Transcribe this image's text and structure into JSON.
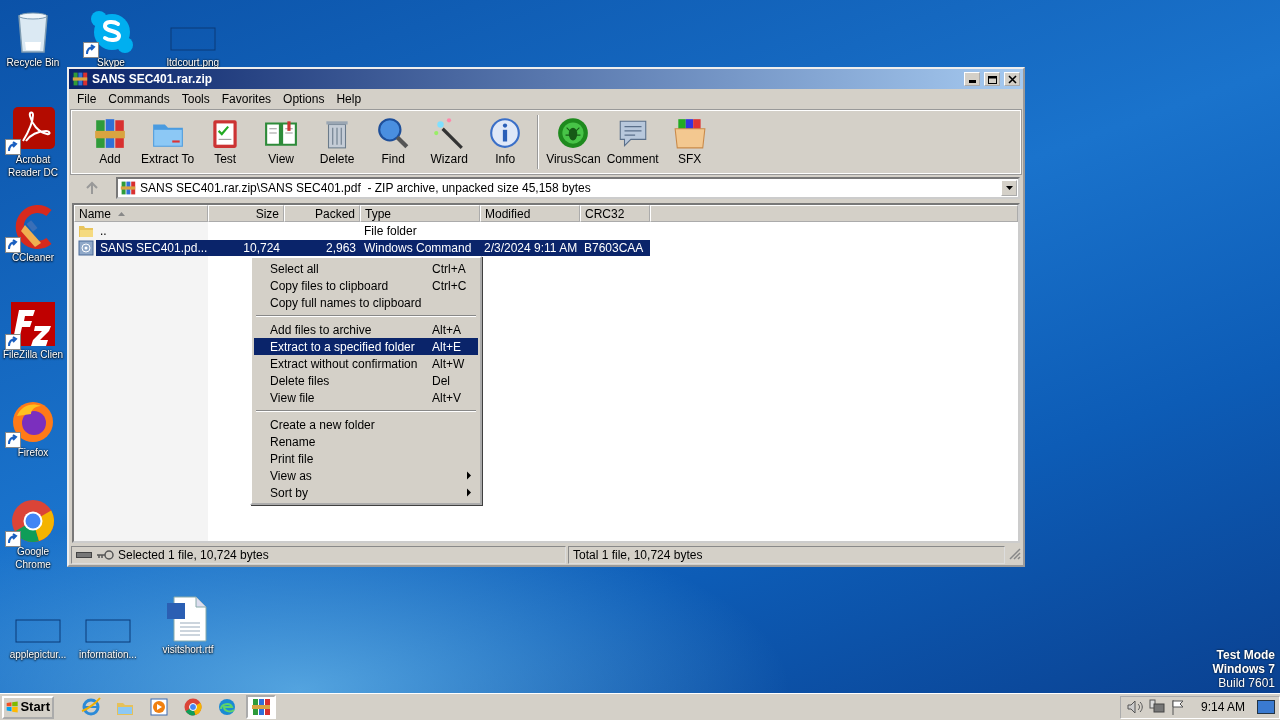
{
  "desktop_icons": [
    {
      "label": "Recycle Bin",
      "kind": "recycle",
      "shortcut": false
    },
    {
      "label": "Skype",
      "kind": "skype",
      "shortcut": true
    },
    {
      "label": "ltdcourt.png",
      "kind": "image",
      "shortcut": false
    },
    {
      "label": "Acrobat Reader DC",
      "kind": "acrobat",
      "shortcut": true
    },
    {
      "label": "CCleaner",
      "kind": "ccleaner",
      "shortcut": true
    },
    {
      "label": "FileZilla Clien",
      "kind": "filezilla",
      "shortcut": true
    },
    {
      "label": "Firefox",
      "kind": "firefox",
      "shortcut": true
    },
    {
      "label": "Google Chrome",
      "kind": "chrome",
      "shortcut": true
    },
    {
      "label": "applepictur...",
      "kind": "image",
      "shortcut": false
    },
    {
      "label": "information...",
      "kind": "image",
      "shortcut": false
    },
    {
      "label": "visitshort.rtf",
      "kind": "word",
      "shortcut": false
    }
  ],
  "window": {
    "title": "SANS SEC401.rar.zip",
    "menu": [
      "File",
      "Commands",
      "Tools",
      "Favorites",
      "Options",
      "Help"
    ],
    "toolbar": [
      {
        "label": "Add",
        "kind": "add",
        "separator_before": false
      },
      {
        "label": "Extract To",
        "kind": "extract",
        "separator_before": false
      },
      {
        "label": "Test",
        "kind": "test",
        "separator_before": false
      },
      {
        "label": "View",
        "kind": "view",
        "separator_before": false
      },
      {
        "label": "Delete",
        "kind": "delete",
        "separator_before": false
      },
      {
        "label": "Find",
        "kind": "find",
        "separator_before": false
      },
      {
        "label": "Wizard",
        "kind": "wizard",
        "separator_before": false
      },
      {
        "label": "Info",
        "kind": "info",
        "separator_before": false
      },
      {
        "label": "VirusScan",
        "kind": "virus",
        "separator_before": true
      },
      {
        "label": "Comment",
        "kind": "comment",
        "separator_before": false
      },
      {
        "label": "SFX",
        "kind": "sfx",
        "separator_before": false
      }
    ],
    "address": "SANS SEC401.rar.zip\\SANS SEC401.pdf  - ZIP archive, unpacked size 45,158 bytes",
    "columns": [
      {
        "label": "Name",
        "sorted": true
      },
      {
        "label": "Size",
        "sorted": false
      },
      {
        "label": "Packed",
        "sorted": false
      },
      {
        "label": "Type",
        "sorted": false
      },
      {
        "label": "Modified",
        "sorted": false
      },
      {
        "label": "CRC32",
        "sorted": false
      }
    ],
    "rows": [
      {
        "kind": "folder",
        "selected": false,
        "name": "..",
        "type": "File folder"
      },
      {
        "kind": "file",
        "selected": true,
        "name": "SANS SEC401.pd...",
        "size": "10,724",
        "packed": "2,963",
        "type": "Windows Command",
        "modified": "2/3/2024 9:11 AM",
        "crc32": "B7603CAA"
      }
    ],
    "status": [
      "Selected 1 file, 10,724 bytes",
      "Total 1 file, 10,724 bytes"
    ]
  },
  "context_menu": [
    [
      {
        "label": "Select all",
        "shortcut": "Ctrl+A",
        "selected": false,
        "submenu": false
      },
      {
        "label": "Copy files to clipboard",
        "shortcut": "Ctrl+C",
        "selected": false,
        "submenu": false
      },
      {
        "label": "Copy full names to clipboard",
        "selected": false,
        "submenu": false
      }
    ],
    [
      {
        "label": "Add files to archive",
        "shortcut": "Alt+A",
        "selected": false,
        "submenu": false
      },
      {
        "label": "Extract to a specified folder",
        "shortcut": "Alt+E",
        "selected": true,
        "submenu": false
      },
      {
        "label": "Extract without confirmation",
        "shortcut": "Alt+W",
        "selected": false,
        "submenu": false
      },
      {
        "label": "Delete files",
        "shortcut": "Del",
        "selected": false,
        "submenu": false
      },
      {
        "label": "View file",
        "shortcut": "Alt+V",
        "selected": false,
        "submenu": false
      }
    ],
    [
      {
        "label": "Create a new folder",
        "selected": false,
        "submenu": false
      },
      {
        "label": "Rename",
        "selected": false,
        "submenu": false
      },
      {
        "label": "Print file",
        "selected": false,
        "submenu": false
      },
      {
        "label": "View as",
        "selected": false,
        "submenu": true
      },
      {
        "label": "Sort by",
        "selected": false,
        "submenu": true
      }
    ]
  ],
  "taskbar": {
    "start": "Start",
    "apps": [
      {
        "kind": "ie",
        "active": false
      },
      {
        "kind": "explorer",
        "active": false
      },
      {
        "kind": "media",
        "active": false
      },
      {
        "kind": "chrome",
        "active": false
      },
      {
        "kind": "edge",
        "active": false
      },
      {
        "kind": "winrar",
        "active": true
      }
    ],
    "clock": "9:14 AM"
  },
  "desktop_notice": [
    "Test Mode",
    "Windows 7",
    "Build 7601"
  ]
}
